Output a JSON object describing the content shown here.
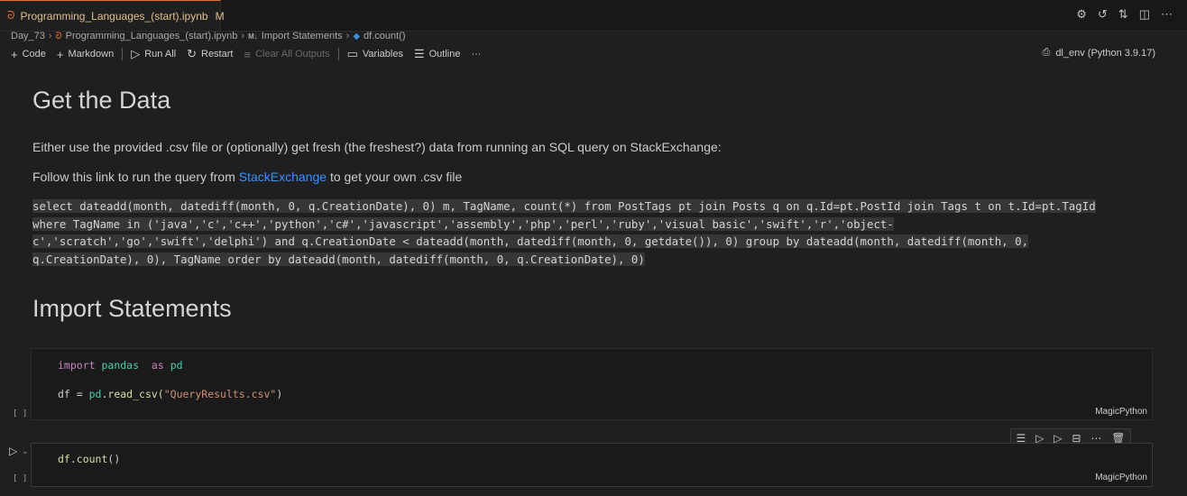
{
  "tab": {
    "title": "Programming_Languages_(start).ipynb",
    "modified": "M"
  },
  "breadcrumb": {
    "folder": "Day_73",
    "notebook": "Programming_Languages_(start).ipynb",
    "md_badge": "M↓",
    "section": "Import Statements",
    "cell": "df.count()"
  },
  "toolbar": {
    "code": "Code",
    "markdown": "Markdown",
    "run_all": "Run All",
    "restart": "Restart",
    "clear_all": "Clear All Outputs",
    "variables": "Variables",
    "outline": "Outline",
    "more": "···"
  },
  "kernel": {
    "label": "dl_env (Python 3.9.17)"
  },
  "content": {
    "h1_data": "Get the Data",
    "p1": "Either use the provided .csv file or (optionally) get fresh (the freshest?) data from running an SQL query on StackExchange:",
    "p2_before": "Follow this link to run the query from ",
    "p2_link": "StackExchange",
    "p2_after": " to get your own .csv file",
    "sql_lines": [
      "select dateadd(month, datediff(month, 0, q.CreationDate), 0) m, TagName, count(*) from PostTags pt join Posts q on q.Id=pt.PostId join Tags t on t.Id=pt.TagId",
      "where TagName in ('java','c','c++','python','c#','javascript','assembly','php','perl','ruby','visual basic','swift','r','object-",
      "c','scratch','go','swift','delphi') and q.CreationDate < dateadd(month, datediff(month, 0, getdate()), 0) group by dateadd(month, datediff(month, 0,",
      "q.CreationDate), 0), TagName order by dateadd(month, datediff(month, 0, q.CreationDate), 0)"
    ],
    "h1_import": "Import Statements"
  },
  "cell1": {
    "import_kw": "import",
    "module": "pandas",
    "as_kw": "as",
    "alias": "pd",
    "line2_var": "df = ",
    "line2_mod": "pd",
    "line2_fn": ".read_csv(",
    "line2_str": "\"QueryResults.csv\"",
    "line2_end": ")",
    "exec": "[ ]",
    "lang": "MagicPython"
  },
  "cell2": {
    "code_fn": "df.count",
    "code_end": "()",
    "exec": "[ ]",
    "lang": "MagicPython"
  },
  "colors": {
    "accent_orange": "#e6702e",
    "link": "#3794ff",
    "bg": "#1f1f1f"
  }
}
